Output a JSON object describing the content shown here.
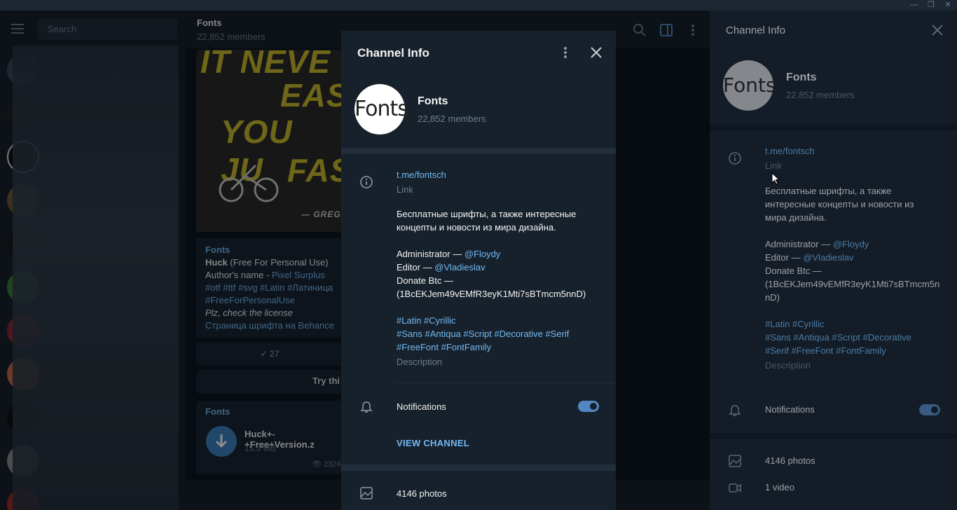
{
  "window": {
    "minimize_glyph": "—",
    "restore_glyph": "❐",
    "close_glyph": "✕"
  },
  "sidebar": {
    "search_placeholder": "Search"
  },
  "chat": {
    "title": "Fonts",
    "members": "22,852 members",
    "image_lines": [
      "IT NEVE",
      "EAS",
      "YOU JU",
      "FAS",
      "— GREG"
    ],
    "post": {
      "channel": "Fonts",
      "title_bold": "Huck",
      "title_rest": " (Free For Personal Use)",
      "author_prefix": "Author's name - ",
      "author_link": "Pixel Surplus",
      "tags1": " #otf #ttf #svg #Latin #Латиница",
      "tags2": "#FreeForPersonalUse",
      "license": "Plz, check the license",
      "behance": "Страница шрифта на Behance"
    },
    "reaction_count": "27",
    "try_label": "Try thi",
    "file": {
      "channel": "Fonts",
      "name": "Huck+-+Free+Version.z",
      "size": "15.5 MB",
      "views": "2324"
    }
  },
  "modal": {
    "title": "Channel Info",
    "channel_name": "Fonts",
    "avatar_text": "Fonts",
    "members": "22,852 members",
    "link": "t.me/fontsch",
    "link_label": "Link",
    "description_lines": [
      "Бесплатные шрифты, а также интересные",
      "концепты и новости из мира дизайна."
    ],
    "admin_prefix": "Administrator — ",
    "admin_handle": "@Floydy",
    "editor_prefix": "Editor — ",
    "editor_handle": "@Vladieslav",
    "donate_label": "Donate Btc —",
    "donate_address": "(1BcEKJem49vEMfR3eyK1Mti7sBTmcm5nnD)",
    "tags_line1": "#Latin #Cyrillic",
    "tags_line2": "#Sans #Antiqua #Script #Decorative #Serif",
    "tags_line3": "#FreeFont #FontFamily",
    "description_label": "Description",
    "notifications_label": "Notifications",
    "notifications_on": true,
    "view_channel": "VIEW CHANNEL",
    "photos": "4146 photos"
  },
  "info_panel": {
    "title": "Channel Info",
    "channel_name": "Fonts",
    "avatar_text": "Fonts",
    "members": "22,852 members",
    "link": "t.me/fontsch",
    "link_label": "Link",
    "description_lines": [
      "Бесплатные шрифты, а также",
      "интересные концепты и новости из",
      "мира дизайна."
    ],
    "admin_prefix": "Administrator — ",
    "admin_handle": "@Floydy",
    "editor_prefix": "Editor — ",
    "editor_handle": "@Vladieslav",
    "donate_label": "Donate Btc —",
    "donate_address_1": "(1BcEKJem49vEMfR3eyK1Mti7sBTmcm5n",
    "donate_address_2": "nD)",
    "tags_line1": "#Latin #Cyrillic",
    "tags_line2": "#Sans #Antiqua #Script #Decorative",
    "tags_line3": "#Serif #FreeFont #FontFamily",
    "description_label": "Description",
    "notifications_label": "Notifications",
    "photos": "4146 photos",
    "videos": "1 video"
  },
  "colors": {
    "accent": "#71baf5",
    "toggle": "#5288c1",
    "panel": "#17212b",
    "background": "#0e1621"
  }
}
